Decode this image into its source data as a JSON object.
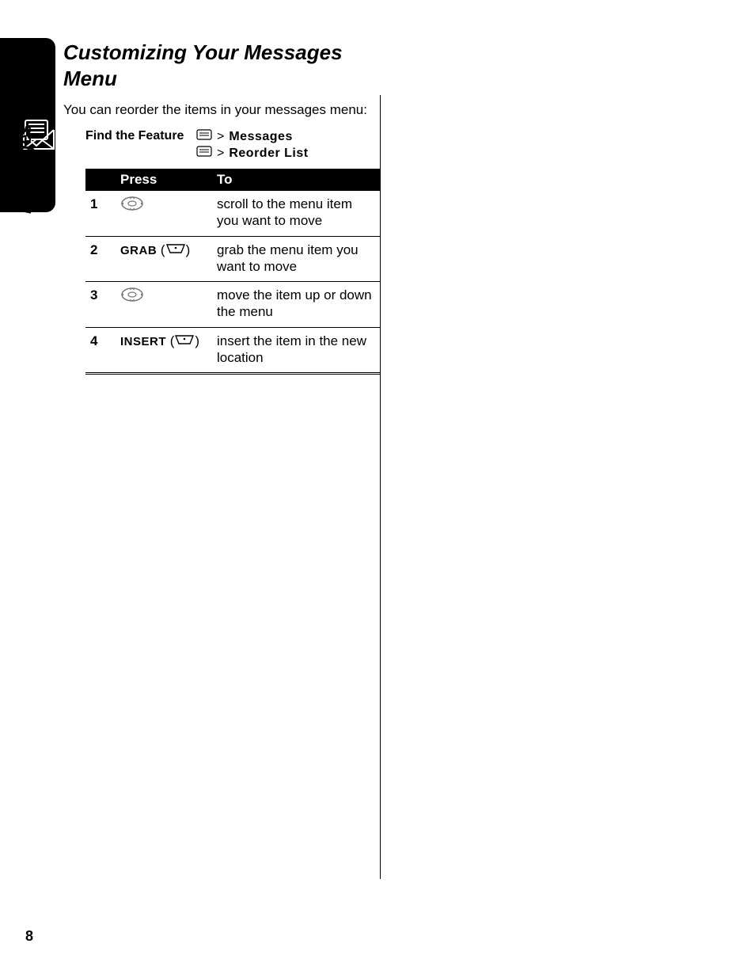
{
  "sideLabel": "Messages",
  "pageNumber": "8",
  "heading": "Customizing Your Messages Menu",
  "intro": "You can reorder the items in your messages menu:",
  "feature": {
    "label": "Find the Feature",
    "path1": "Messages",
    "path2": "Reorder List",
    "gt": ">"
  },
  "table": {
    "headers": {
      "num": "",
      "press": "Press",
      "to": "To"
    },
    "rows": [
      {
        "num": "1",
        "pressLabel": "",
        "icon": "nav",
        "to": "scroll to the menu item you want to move"
      },
      {
        "num": "2",
        "pressLabel": "GRAB",
        "icon": "softkey",
        "to": "grab the menu item you want to move"
      },
      {
        "num": "3",
        "pressLabel": "",
        "icon": "nav",
        "to": "move the item up or down the menu"
      },
      {
        "num": "4",
        "pressLabel": "INSERT",
        "icon": "softkey",
        "to": "insert the item in the new location"
      }
    ]
  }
}
